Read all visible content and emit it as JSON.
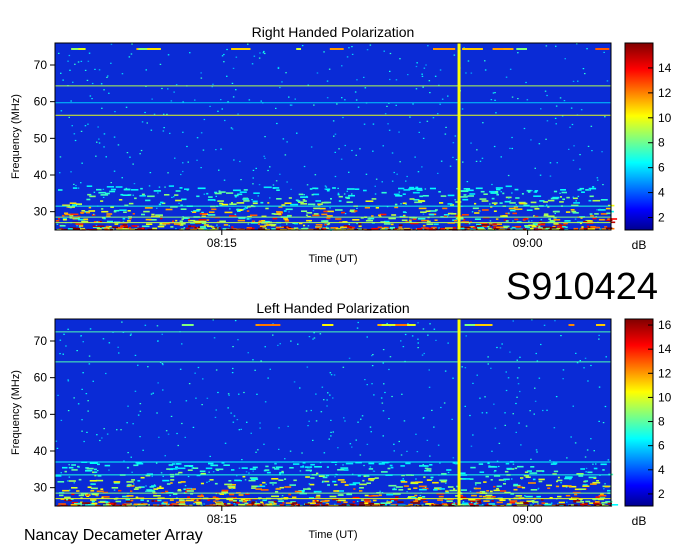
{
  "event_id": "S910424",
  "footer": "Nancay Decameter Array",
  "colorbar_unit": "dB",
  "chart_data": [
    {
      "type": "heatmap",
      "title": "Right Handed Polarization",
      "xlabel": "Time (UT)",
      "ylabel": "Frequency (MHz)",
      "x_ticks": [
        "08:15",
        "09:00"
      ],
      "y_ticks": [
        30,
        40,
        50,
        60,
        70
      ],
      "ylim": [
        25,
        76
      ],
      "colorbar_ticks": [
        2,
        4,
        6,
        8,
        10,
        12,
        14
      ],
      "colorbar_range": [
        1,
        16
      ],
      "colorbar_unit": "dB"
    },
    {
      "type": "heatmap",
      "title": "Left Handed Polarization",
      "xlabel": "Time (UT)",
      "ylabel": "Frequency (MHz)",
      "x_ticks": [
        "08:15",
        "09:00"
      ],
      "y_ticks": [
        30,
        40,
        50,
        60,
        70
      ],
      "ylim": [
        25,
        76
      ],
      "colorbar_ticks": [
        2,
        4,
        6,
        8,
        10,
        12,
        14,
        16
      ],
      "colorbar_range": [
        1,
        16.5
      ],
      "colorbar_unit": "dB"
    }
  ]
}
